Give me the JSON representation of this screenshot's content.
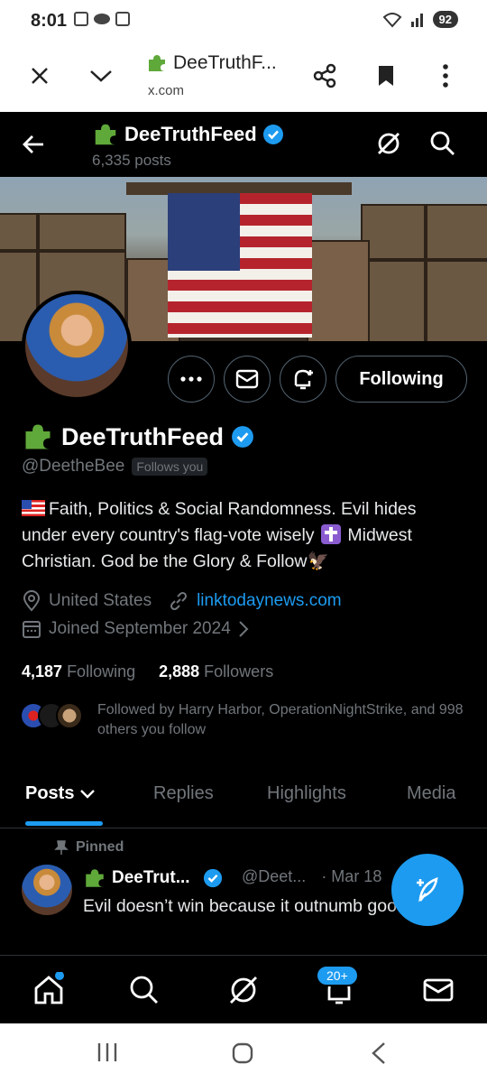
{
  "status_bar": {
    "time": "8:01",
    "battery": "92"
  },
  "custom_tab": {
    "title": "DeeTruthF...",
    "domain": "x.com"
  },
  "header": {
    "name": "DeeTruthFeed",
    "post_count": "6,335 posts"
  },
  "profile": {
    "display_name": "DeeTruthFeed",
    "handle": "@DeetheBee",
    "follows_you": "Follows you",
    "follow_button": "Following",
    "bio_line1": "Faith, Politics & Social Randomness.  Evil hides",
    "bio_line2a": "under every country's flag-vote wisely",
    "bio_line2b": "Midwest",
    "bio_line3": "Christian. God be the Glory & Follow🦅",
    "location": "United States",
    "link": "linktodaynews.com",
    "joined": "Joined September 2024",
    "following_count": "4,187",
    "following_label": "Following",
    "followers_count": "2,888",
    "followers_label": "Followers",
    "followed_by": "Followed by Harry Harbor, OperationNightStrike, and 998 others you follow"
  },
  "tabs": [
    "Posts",
    "Replies",
    "Highlights",
    "Media"
  ],
  "pinned_tweet": {
    "pinned_label": "Pinned",
    "name": "DeeTrut...",
    "handle": "@Deet...",
    "date": "· Mar 18",
    "text": "Evil doesn’t win because it outnumb good."
  },
  "bottom_nav": {
    "notifications_badge": "20+"
  },
  "colors": {
    "accent": "#1d9bf0",
    "background": "#000000",
    "muted": "#71767b"
  }
}
